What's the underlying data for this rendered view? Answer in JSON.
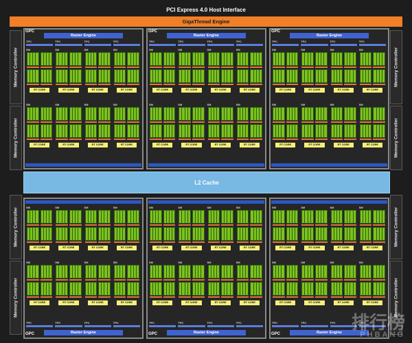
{
  "header": {
    "pci": "PCI Express 4.0 Host Interface",
    "gigathread": "GigaThread Engine"
  },
  "memory_controller_label": "Memory Controller",
  "l2_cache": "L2 Cache",
  "gpc": {
    "label": "GPC",
    "raster": "Raster Engine",
    "tpc": "TPC",
    "polymorph": "PolyMorph Engine",
    "sm": "SM",
    "rt_core": "RT CORE"
  },
  "watermark": {
    "main": "排行榜",
    "sub": "PHBANG"
  },
  "colors": {
    "orange": "#f07f27",
    "l2_blue": "#78b9e3",
    "raster_blue": "#3f63d1",
    "cuda_green": "#7cc21e",
    "rt_yellow": "#f4ef7a"
  }
}
